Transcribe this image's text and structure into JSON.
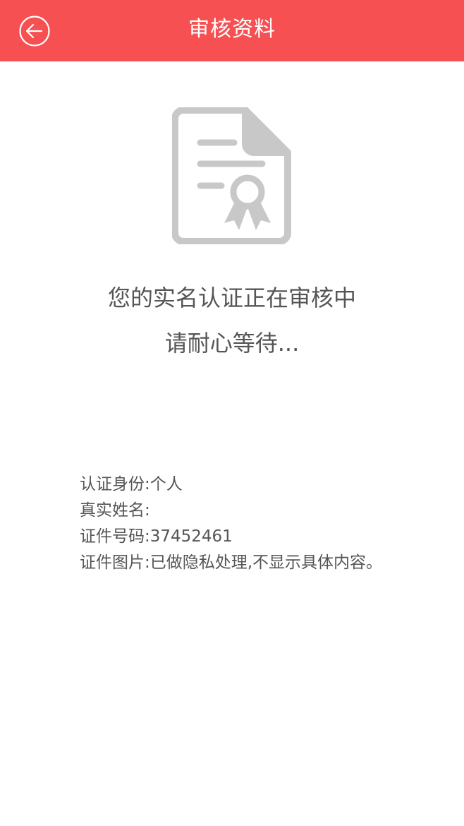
{
  "header": {
    "title": "审核资料",
    "back_icon": "back-arrow-circle-icon",
    "background": "#f65052"
  },
  "status": {
    "icon": "certificate-document-icon",
    "line1": "您的实名认证正在审核中",
    "line2": "请耐心等待..."
  },
  "info": [
    {
      "label": "认证身份:",
      "value": "个人"
    },
    {
      "label": "真实姓名:",
      "value": ""
    },
    {
      "label": "证件号码:",
      "value": "37452461"
    },
    {
      "label": "证件图片:",
      "value": "已做隐私处理,不显示具体内容。"
    }
  ]
}
